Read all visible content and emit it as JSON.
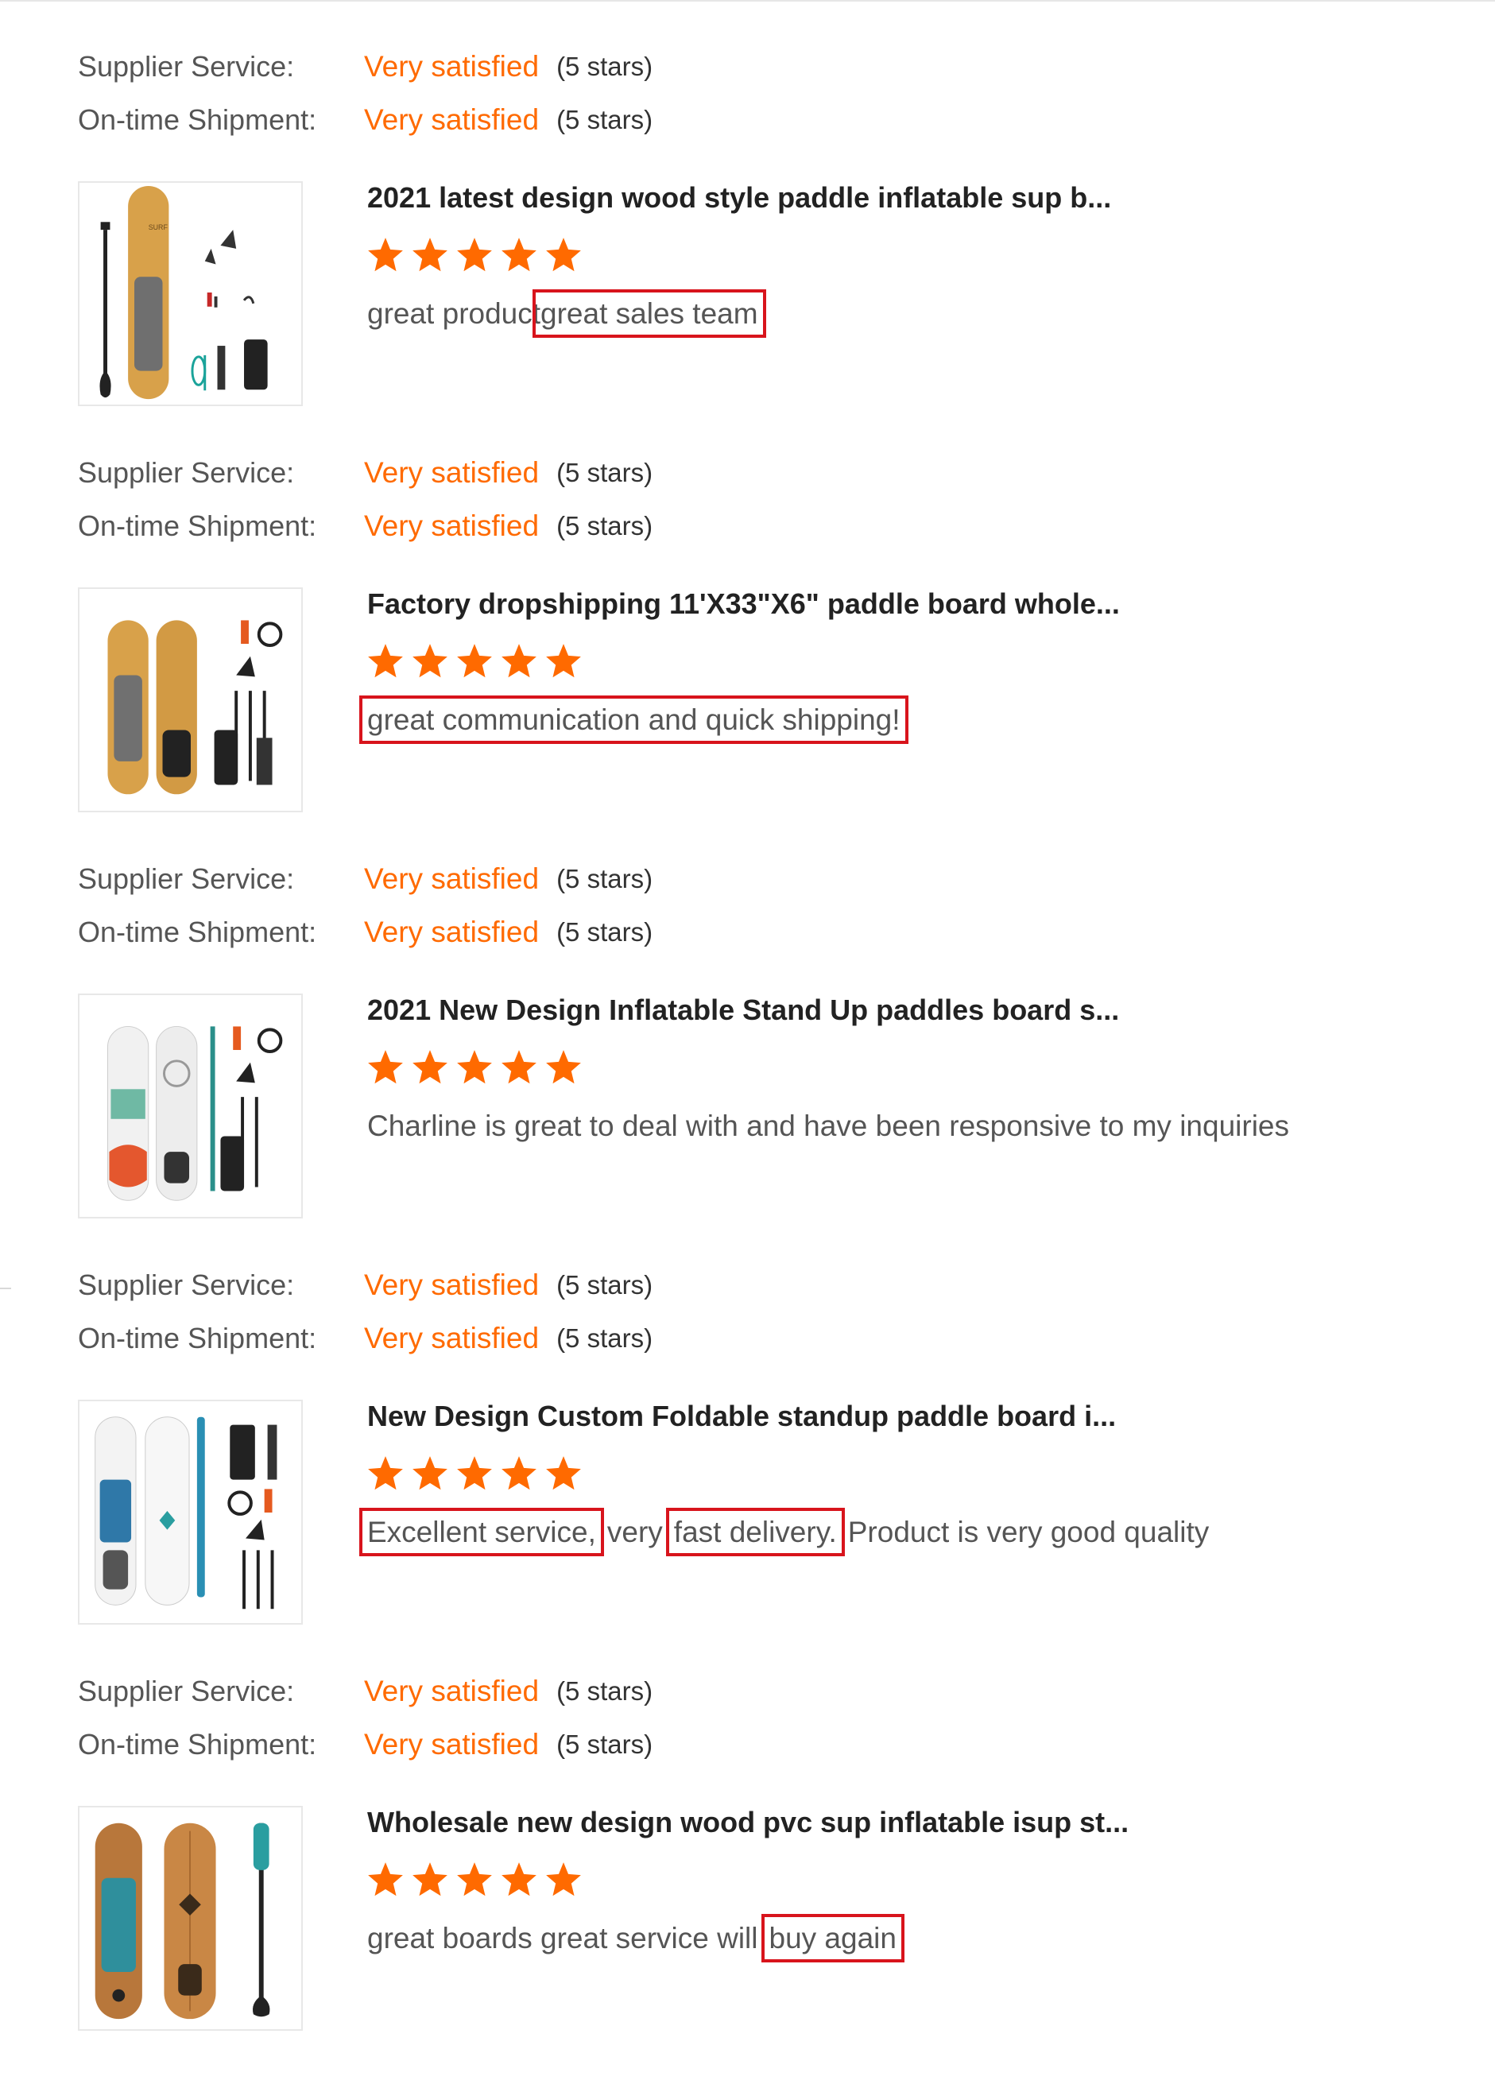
{
  "rating_labels": {
    "supplier": "Supplier Service:",
    "shipment": "On-time Shipment:"
  },
  "colors": {
    "accent": "#ff6a00",
    "highlight_box": "#d8141c",
    "star": "#ff6a00"
  },
  "reviews": [
    {
      "supplier_service": {
        "value": "Very satisfied",
        "stars": "(5 stars)"
      },
      "ontime_shipment": {
        "value": "Very satisfied",
        "stars": "(5 stars)"
      },
      "product_title": "2021 latest design wood style paddle inflatable sup b...",
      "star_rating": 5,
      "thumbnail_icon": "wood-paddle-board-kit-image",
      "comment": {
        "p1": "great product",
        "h1": "great sales team"
      }
    },
    {
      "supplier_service": {
        "value": "Very satisfied",
        "stars": "(5 stars)"
      },
      "ontime_shipment": {
        "value": "Very satisfied",
        "stars": "(5 stars)"
      },
      "product_title": "Factory dropshipping 11'X33\"X6\" paddle board whole...",
      "star_rating": 5,
      "thumbnail_icon": "twin-wood-paddle-boards-image",
      "comment": {
        "h1": "great communication and quick shipping!"
      }
    },
    {
      "supplier_service": {
        "value": "Very satisfied",
        "stars": "(5 stars)"
      },
      "ontime_shipment": {
        "value": "Very satisfied",
        "stars": "(5 stars)"
      },
      "product_title": "2021 New Design Inflatable Stand Up paddles board s...",
      "star_rating": 5,
      "thumbnail_icon": "white-teal-paddle-boards-image",
      "comment": {
        "p1": "Charline is great to deal with and have been responsive to my inquiries"
      }
    },
    {
      "supplier_service": {
        "value": "Very satisfied",
        "stars": "(5 stars)"
      },
      "ontime_shipment": {
        "value": "Very satisfied",
        "stars": "(5 stars)"
      },
      "product_title": "New Design Custom Foldable standup paddle board i...",
      "star_rating": 5,
      "thumbnail_icon": "blue-white-paddle-boards-image",
      "comment": {
        "h1": "Excellent service,",
        "p2": "very",
        "h2": "fast delivery.",
        "p3": "Product is very good quality"
      }
    },
    {
      "supplier_service": {
        "value": "Very satisfied",
        "stars": "(5 stars)"
      },
      "ontime_shipment": {
        "value": "Very satisfied",
        "stars": "(5 stars)"
      },
      "product_title": "Wholesale new design wood pvc sup inflatable isup st...",
      "star_rating": 5,
      "thumbnail_icon": "wood-teal-paddle-boards-image",
      "comment": {
        "p1": "great boards great service will",
        "h1": "buy again"
      }
    }
  ]
}
